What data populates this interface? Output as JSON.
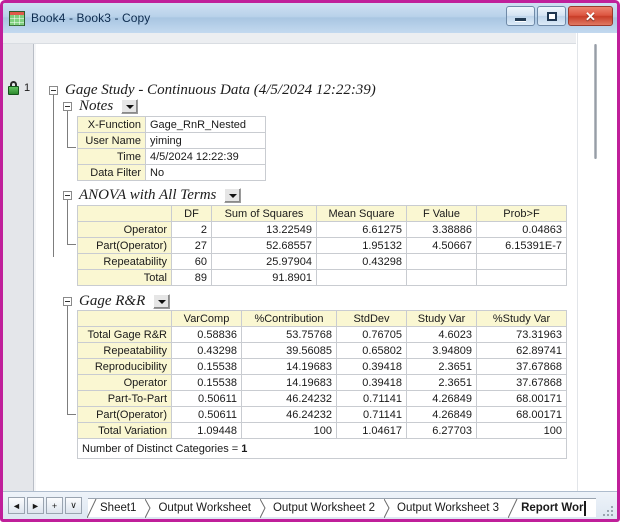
{
  "window": {
    "title": "Book4 - Book3 - Copy",
    "icon": "workbook-icon",
    "minimize_label": "",
    "maximize_label": "",
    "close_label": "✕",
    "border_color": "#c01f9a"
  },
  "report": {
    "row_number": "1",
    "lock_icon": "lock-icon",
    "title": "Gage Study - Continuous Data (4/5/2024 12:22:39)"
  },
  "notes": {
    "section_title": "Notes",
    "rows": [
      {
        "label": "X-Function",
        "value": "Gage_RnR_Nested"
      },
      {
        "label": "User Name",
        "value": "yiming"
      },
      {
        "label": "Time",
        "value": "4/5/2024 12:22:39"
      },
      {
        "label": "Data Filter",
        "value": "No"
      }
    ]
  },
  "anova": {
    "section_title": "ANOVA with All Terms",
    "columns": [
      "",
      "DF",
      "Sum of Squares",
      "Mean Square",
      "F Value",
      "Prob>F"
    ],
    "rows": [
      {
        "label": "Operator",
        "df": "2",
        "ss": "13.22549",
        "ms": "6.61275",
        "f": "3.38886",
        "p": "0.04863"
      },
      {
        "label": "Part(Operator)",
        "df": "27",
        "ss": "52.68557",
        "ms": "1.95132",
        "f": "4.50667",
        "p": "6.15391E-7"
      },
      {
        "label": "Repeatability",
        "df": "60",
        "ss": "25.97904",
        "ms": "0.43298",
        "f": "",
        "p": ""
      },
      {
        "label": "Total",
        "df": "89",
        "ss": "91.8901",
        "ms": "",
        "f": "",
        "p": ""
      }
    ]
  },
  "gagernr": {
    "section_title": "Gage R&R",
    "columns": [
      "",
      "VarComp",
      "%Contribution",
      "StdDev",
      "Study Var",
      "%Study Var"
    ],
    "rows": [
      {
        "label": "Total Gage R&R",
        "varcomp": "0.58836",
        "contrib": "53.75768",
        "stddev": "0.76705",
        "studyvar": "4.6023",
        "pstudyvar": "73.31963"
      },
      {
        "label": "Repeatability",
        "varcomp": "0.43298",
        "contrib": "39.56085",
        "stddev": "0.65802",
        "studyvar": "3.94809",
        "pstudyvar": "62.89741"
      },
      {
        "label": "Reproducibility",
        "varcomp": "0.15538",
        "contrib": "14.19683",
        "stddev": "0.39418",
        "studyvar": "2.3651",
        "pstudyvar": "37.67868"
      },
      {
        "label": "Operator",
        "varcomp": "0.15538",
        "contrib": "14.19683",
        "stddev": "0.39418",
        "studyvar": "2.3651",
        "pstudyvar": "37.67868"
      },
      {
        "label": "Part-To-Part",
        "varcomp": "0.50611",
        "contrib": "46.24232",
        "stddev": "0.71141",
        "studyvar": "4.26849",
        "pstudyvar": "68.00171"
      },
      {
        "label": "Part(Operator)",
        "varcomp": "0.50611",
        "contrib": "46.24232",
        "stddev": "0.71141",
        "studyvar": "4.26849",
        "pstudyvar": "68.00171"
      },
      {
        "label": "Total Variation",
        "varcomp": "1.09448",
        "contrib": "100",
        "stddev": "1.04617",
        "studyvar": "6.27703",
        "pstudyvar": "100"
      }
    ],
    "footnote_label": "Number of Distinct Categories = ",
    "footnote_value": "1",
    "footnote_color": "#2b2bd0"
  },
  "tabbar": {
    "nav": [
      {
        "name": "prev-sheet-button",
        "glyph": "◄"
      },
      {
        "name": "next-sheet-button",
        "glyph": "►"
      },
      {
        "name": "add-sheet-button",
        "glyph": "+"
      },
      {
        "name": "sheet-list-button",
        "glyph": "∨"
      }
    ],
    "tabs": [
      {
        "label": "Sheet1",
        "active": false
      },
      {
        "label": "Output Worksheet",
        "active": false
      },
      {
        "label": "Output Worksheet 2",
        "active": false
      },
      {
        "label": "Output Worksheet 3",
        "active": false
      },
      {
        "label": "Report Wor",
        "active": true
      }
    ]
  }
}
